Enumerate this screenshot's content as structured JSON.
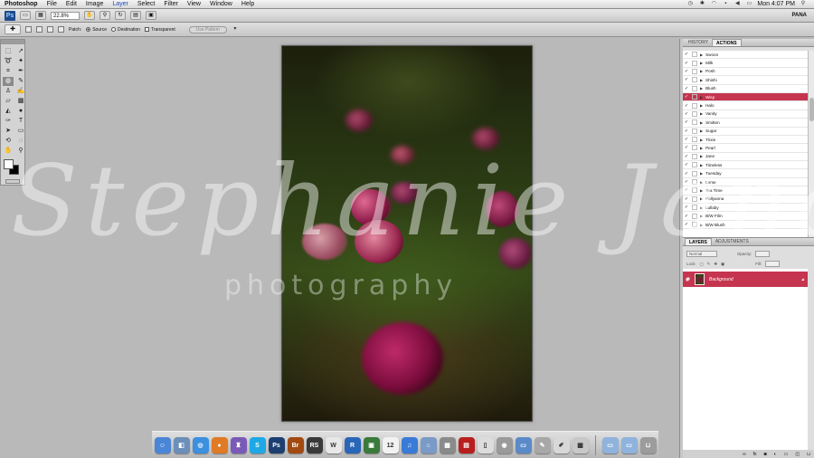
{
  "menubar": {
    "app_name": "Photoshop",
    "items": [
      "File",
      "Edit",
      "Image",
      "Layer",
      "Select",
      "Filter",
      "View",
      "Window",
      "Help"
    ],
    "active_item": "Layer",
    "clock": "Mon 4:07 PM"
  },
  "appbar": {
    "zoom": "22.8%",
    "workspace": "PANA"
  },
  "options_bar": {
    "tool_label": "Patch:",
    "source_label": "Source",
    "destination_label": "Destination",
    "transparent_label": "Transparent",
    "use_pattern_label": "Use Pattern"
  },
  "watermark": {
    "script": "Stephanie Jana",
    "sub": "photography"
  },
  "actions_panel": {
    "tabs": [
      "HISTORY",
      "ACTIONS"
    ],
    "active_tab": "ACTIONS",
    "items": [
      "Swoon",
      "Milk",
      "Posh",
      "Shishi",
      "Blush",
      "Wisp",
      "Halo",
      "Vanity",
      "Smitten",
      "Sugar",
      "Trixie",
      "Pearl",
      "Jane",
      "Timeless",
      "Tuesday",
      "Lume",
      "Tea Time",
      "Pollyanna",
      "Lullaby",
      "B/W Film",
      "B/W Blush"
    ],
    "selected": "Wisp"
  },
  "layers_panel": {
    "tabs": [
      "LAYERS",
      "ADJUSTMENTS"
    ],
    "active_tab": "LAYERS",
    "blend_mode": "Normal",
    "opacity_label": "Opacity:",
    "lock_label": "Lock:",
    "fill_label": "Fill:",
    "layer_name": "Background"
  },
  "dock": {
    "apps": [
      {
        "name": "Finder",
        "icon": "finder-icon",
        "color": "#4a86d8",
        "glyph": "☺"
      },
      {
        "name": "Preview",
        "icon": "preview-icon",
        "color": "#6b8fb8",
        "glyph": "◧"
      },
      {
        "name": "Safari",
        "icon": "safari-icon",
        "color": "#3d8fe0",
        "glyph": "◎"
      },
      {
        "name": "Firefox",
        "icon": "firefox-icon",
        "color": "#e07a24",
        "glyph": "●"
      },
      {
        "name": "Automator",
        "icon": "automator-icon",
        "color": "#7a5ab8",
        "glyph": "♜"
      },
      {
        "name": "Skype",
        "icon": "skype-icon",
        "color": "#1ea8e6",
        "glyph": "S"
      },
      {
        "name": "Photoshop",
        "icon": "photoshop-icon",
        "color": "#1d3f70",
        "glyph": "Ps"
      },
      {
        "name": "Bridge",
        "icon": "bridge-icon",
        "color": "#a24a12",
        "glyph": "Br"
      },
      {
        "name": "RSS",
        "icon": "rss-icon",
        "color": "#3a3a3a",
        "glyph": "RS"
      },
      {
        "name": "WordPress",
        "icon": "wordpress-icon",
        "color": "#e8e8e8",
        "glyph": "W"
      },
      {
        "name": "R",
        "icon": "r-app-icon",
        "color": "#2a66b8",
        "glyph": "R"
      },
      {
        "name": "Photos",
        "icon": "photos-icon",
        "color": "#3a7a3a",
        "glyph": "▣"
      },
      {
        "name": "Calendar",
        "icon": "calendar-icon",
        "color": "#f2f2f2",
        "glyph": "12"
      },
      {
        "name": "iTunes",
        "icon": "itunes-icon",
        "color": "#3a7bd8",
        "glyph": "♫"
      },
      {
        "name": "App Store",
        "icon": "appstore-icon",
        "color": "#7a9ac8",
        "glyph": "⌂"
      },
      {
        "name": "Calculator",
        "icon": "calculator-icon",
        "color": "#8a8a8a",
        "glyph": "▦"
      },
      {
        "name": "Photo Booth",
        "icon": "photobooth-icon",
        "color": "#b81e1e",
        "glyph": "▤"
      },
      {
        "name": "Preview Doc",
        "icon": "document-icon",
        "color": "#dcdcdc",
        "glyph": "▯"
      },
      {
        "name": "Screen Capture",
        "icon": "camera-icon",
        "color": "#9a9a9a",
        "glyph": "◉"
      },
      {
        "name": "Keynote",
        "icon": "keynote-icon",
        "color": "#5a8ac8",
        "glyph": "▭"
      },
      {
        "name": "Script Editor",
        "icon": "script-icon",
        "color": "#a8a8a8",
        "glyph": "✎"
      },
      {
        "name": "TextEdit",
        "icon": "textedit-icon",
        "color": "#d8d8d8",
        "glyph": "✐"
      },
      {
        "name": "Grapher",
        "icon": "grapher-icon",
        "color": "#c8c8c8",
        "glyph": "▩"
      },
      {
        "name": "Applications",
        "icon": "folder-icon",
        "color": "#8fb3dc",
        "glyph": "▭"
      },
      {
        "name": "Documents",
        "icon": "folder-icon",
        "color": "#8fb3dc",
        "glyph": "▭"
      },
      {
        "name": "Trash",
        "icon": "trash-icon",
        "color": "#9c9c9c",
        "glyph": "⊔"
      }
    ]
  }
}
